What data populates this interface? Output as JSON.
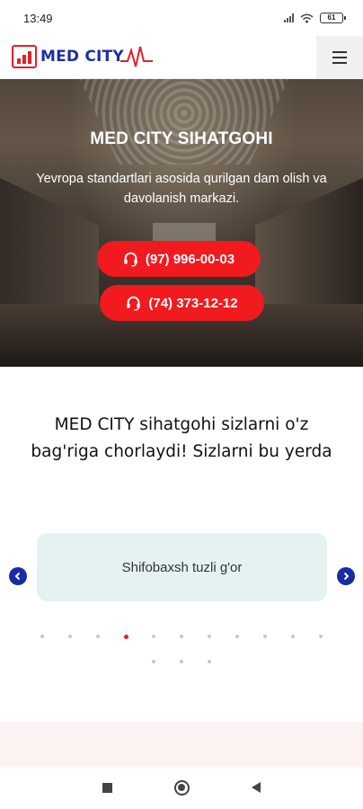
{
  "status_bar": {
    "time": "13:49",
    "battery": "61",
    "icons": [
      "signal-icon",
      "wifi-icon",
      "battery-icon"
    ]
  },
  "header": {
    "logo_text": "MED CITY",
    "menu_icon": "hamburger-icon"
  },
  "hero": {
    "title": "MED CITY SIHATGOHI",
    "subtitle": "Yevropa standartlari asosida qurilgan dam olish va davolanish markazi.",
    "phones": [
      {
        "label": "(97) 996-00-03",
        "icon": "headset-icon"
      },
      {
        "label": "(74) 373-12-12",
        "icon": "headset-icon"
      }
    ]
  },
  "intro": {
    "text": "MED CITY sihatgohi sizlarni o'z bag'riga chorlaydi! Sizlarni bu yerda"
  },
  "slider": {
    "current_slide": "Shifobaxsh tuzli g'or",
    "prev_icon": "chevron-left-icon",
    "next_icon": "chevron-right-icon",
    "dot_count": 14,
    "active_dot_index": 3
  },
  "colors": {
    "brand_red": "#e51f26",
    "button_red": "#f01a1f",
    "brand_blue": "#1d2fa3",
    "card_bg": "#e6f1f1"
  },
  "nav_bar": {
    "icons": [
      "recent-apps-icon",
      "home-icon",
      "back-icon"
    ]
  }
}
